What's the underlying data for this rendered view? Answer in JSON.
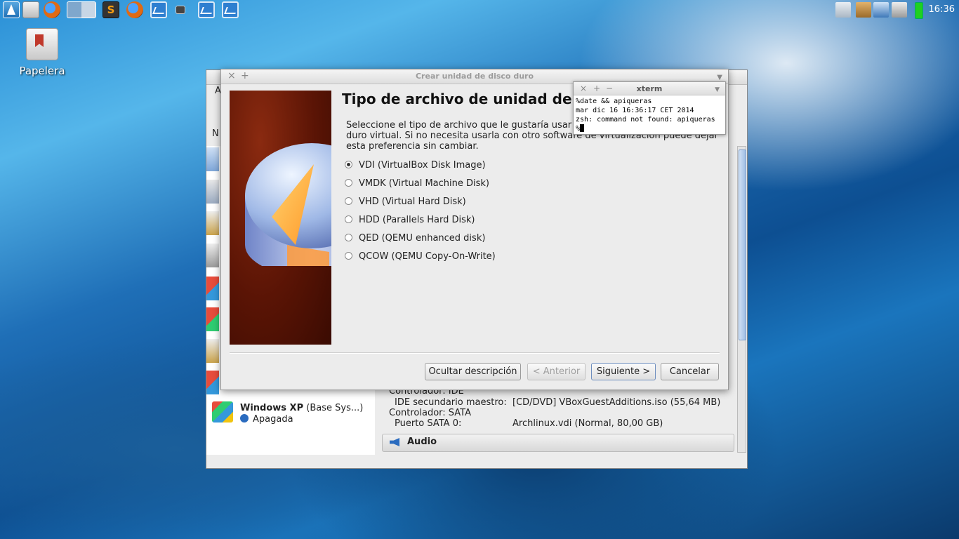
{
  "panel": {
    "clock": "16:36",
    "launchers": [
      "arch-menu-icon",
      "file-manager-icon",
      "firefox-icon",
      "workspace-switcher-icon",
      "sublime-text-icon",
      "firefox-icon",
      "system-monitor-icon",
      "terminal-icon",
      "system-monitor-icon",
      "system-monitor-icon"
    ]
  },
  "desktop": {
    "trash_label": "Papelera"
  },
  "vbox": {
    "menu_initial": "A",
    "name_header_initial": "N",
    "vms": [
      {
        "name": "Windows XP",
        "snapshot": " (Base Sys...)",
        "state": "Apagada"
      }
    ],
    "details": {
      "controller_ide": "Controlador: IDE",
      "ide_secondary_label": "IDE secundario maestro:",
      "ide_secondary_value": "[CD/DVD] VBoxGuestAdditions.iso (55,64 MB)",
      "controller_sata": "Controlador: SATA",
      "sata_port_label": "Puerto SATA 0:",
      "sata_port_value": "Archlinux.vdi (Normal, 80,00 GB)",
      "audio_section": "Audio"
    }
  },
  "dialog": {
    "window_title": "Crear unidad de disco duro",
    "heading": "Tipo de archivo de unidad de d",
    "description": "Seleccione el tipo de archivo que le gustaría usar para la nueva unidad de disco duro virtual. Si no necesita usarla con otro software de virtualización puede dejar esta preferencia sin cambiar.",
    "options": [
      {
        "label": "VDI (VirtualBox Disk Image)",
        "selected": true
      },
      {
        "label": "VMDK (Virtual Machine Disk)",
        "selected": false
      },
      {
        "label": "VHD (Virtual Hard Disk)",
        "selected": false
      },
      {
        "label": "HDD (Parallels Hard Disk)",
        "selected": false
      },
      {
        "label": "QED (QEMU enhanced disk)",
        "selected": false
      },
      {
        "label": "QCOW (QEMU Copy-On-Write)",
        "selected": false
      }
    ],
    "buttons": {
      "hide_description": "Ocultar descripción",
      "back": "< Anterior",
      "next": "Siguiente >",
      "cancel": "Cancelar"
    }
  },
  "xterm": {
    "title": "xterm",
    "lines": [
      "%date && apiqueras",
      "mar dic 16 16:36:17 CET 2014",
      "zsh: command not found: apiqueras",
      "%"
    ]
  }
}
